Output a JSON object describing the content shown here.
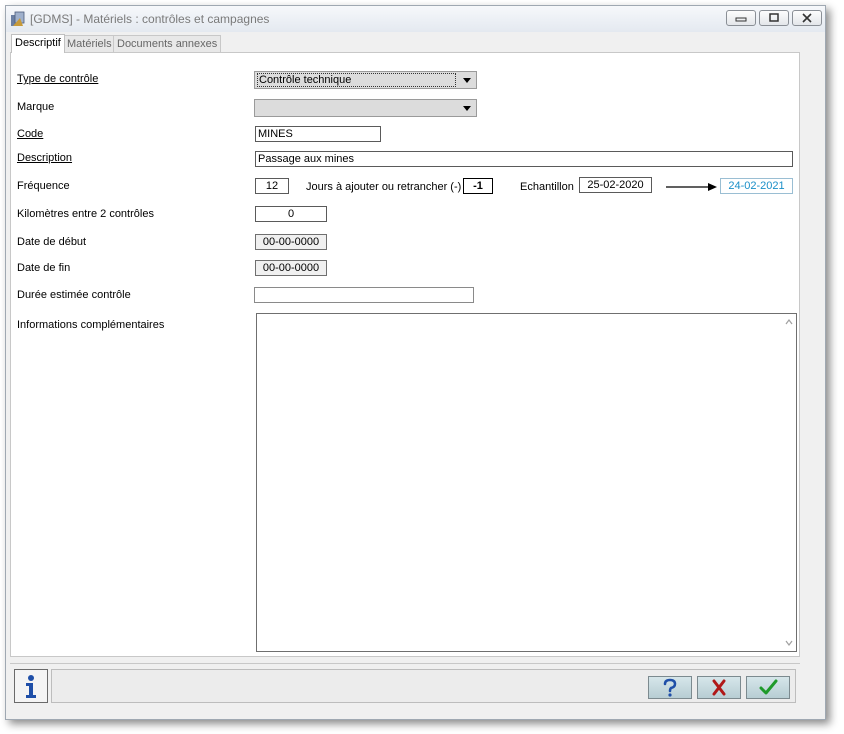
{
  "window": {
    "title": "[GDMS] - Matériels : contrôles et campagnes"
  },
  "tabs": [
    {
      "label": "Descriptif",
      "active": true
    },
    {
      "label": "Matériels",
      "active": false
    },
    {
      "label": "Documents annexes",
      "active": false
    }
  ],
  "form": {
    "type_controle": {
      "label": "Type de contrôle",
      "value": "Contrôle technique"
    },
    "marque": {
      "label": "Marque",
      "value": ""
    },
    "code": {
      "label": "Code",
      "value": "MINES"
    },
    "description": {
      "label": "Description",
      "value": "Passage aux mines"
    },
    "frequence": {
      "label": "Fréquence",
      "value": "12",
      "jours_label": "Jours à ajouter ou retrancher (-)",
      "jours_value": "-1",
      "echantillon_label": "Echantillon",
      "echantillon_value": "25-02-2020",
      "result_value": "24-02-2021"
    },
    "kilometres": {
      "label": "Kilomètres entre 2 contrôles",
      "value": "0"
    },
    "date_debut": {
      "label": "Date de début",
      "value": "00-00-0000"
    },
    "date_fin": {
      "label": "Date de fin",
      "value": "00-00-0000"
    },
    "duree": {
      "label": "Durée estimée contrôle",
      "value": ""
    },
    "infos": {
      "label": "Informations complémentaires",
      "value": ""
    }
  },
  "colors": {
    "result_text": "#1a8fc8",
    "help_icon": "#1f4fa8",
    "cancel_icon": "#b01818",
    "ok_icon": "#1f9a2a"
  },
  "icons": {
    "app": "app-icon",
    "info": "info-icon",
    "help": "question-icon",
    "cancel": "x-icon",
    "ok": "checkmark-icon"
  }
}
